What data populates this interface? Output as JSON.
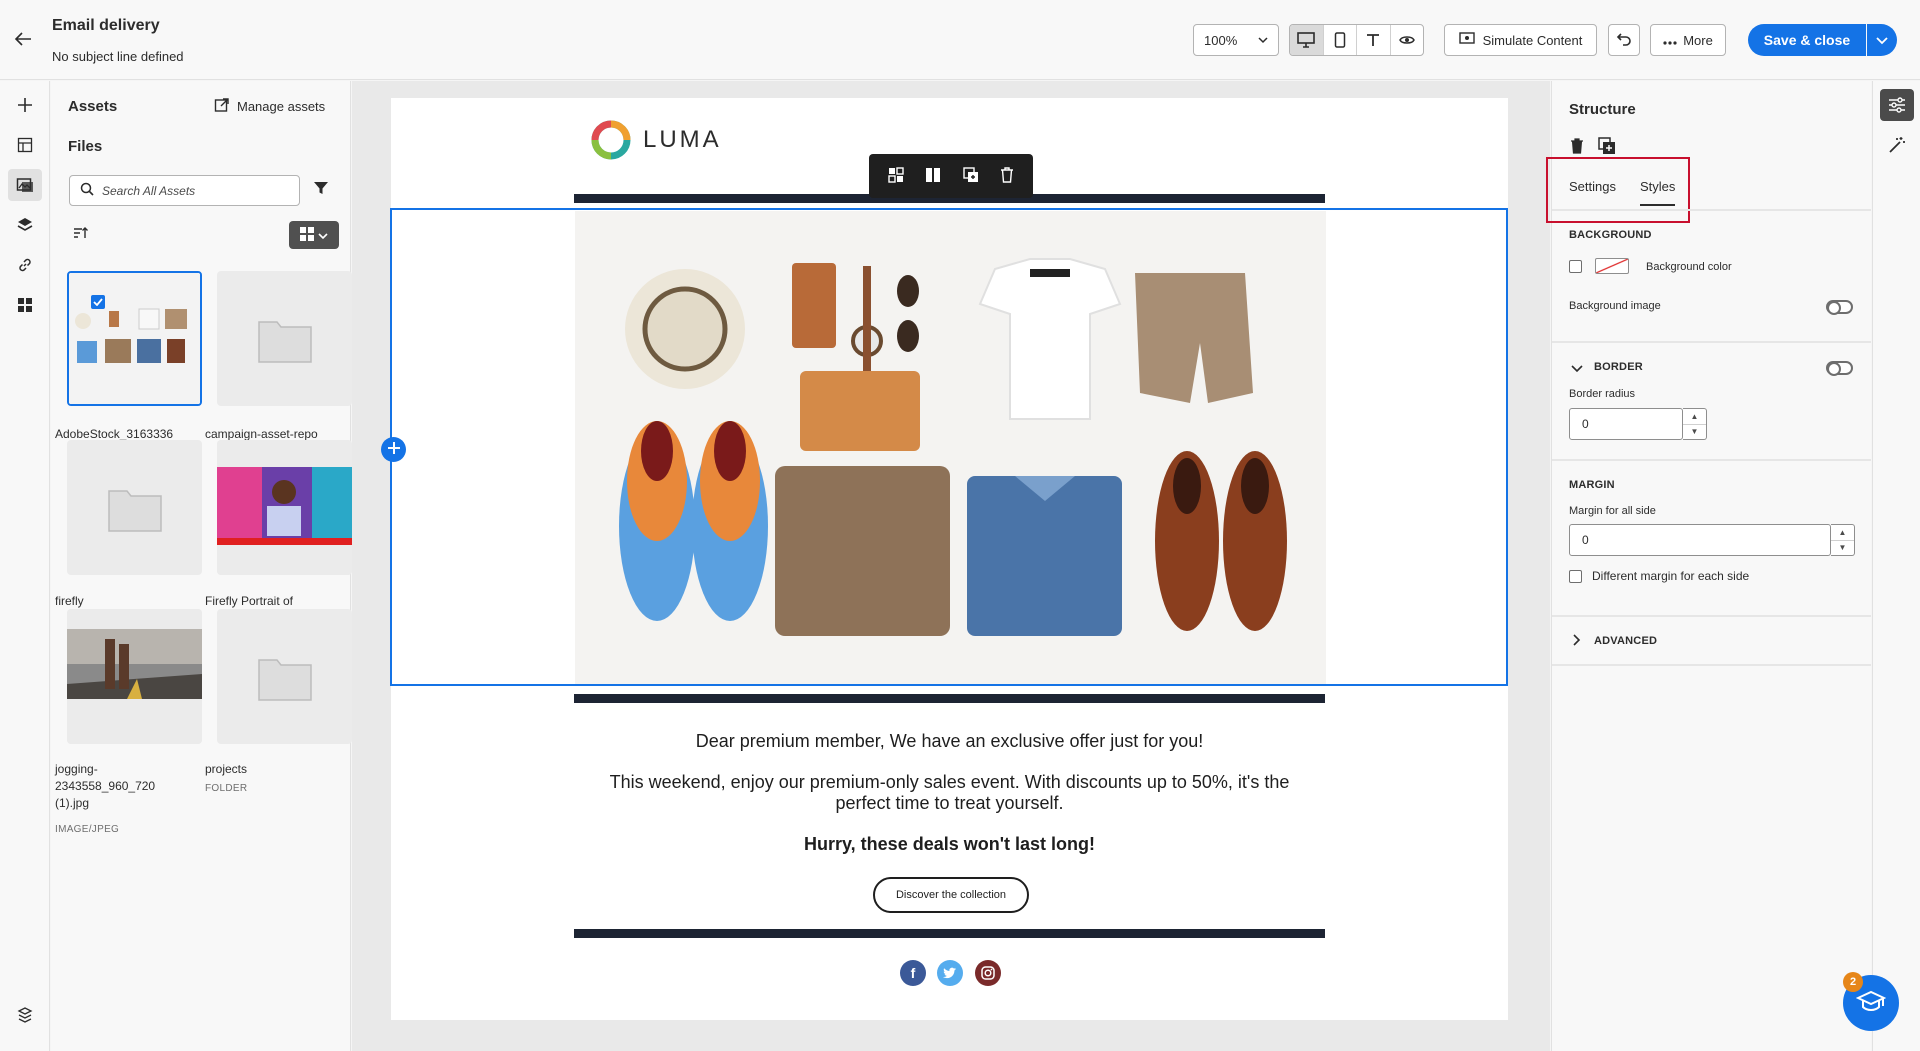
{
  "header": {
    "title": "Email delivery",
    "subtitle": "No subject line defined",
    "zoom": "100%",
    "simulate_label": "Simulate Content",
    "more_label": "More",
    "save_label": "Save & close"
  },
  "left_rail": {
    "icons": [
      "add-icon",
      "fragments-icon",
      "assets-icon",
      "layers-icon",
      "link-icon",
      "components-icon",
      "history-icon"
    ]
  },
  "assets": {
    "title": "Assets",
    "manage_label": "Manage assets",
    "files_heading": "Files",
    "search_placeholder": "Search All Assets",
    "items": [
      {
        "name": "AdobeStock_3163336",
        "type": "",
        "kind": "image",
        "selected": true
      },
      {
        "name": "campaign-asset-repo",
        "type": "",
        "kind": "folder",
        "selected": false
      },
      {
        "name": "firefly",
        "type": "",
        "kind": "folder",
        "selected": false
      },
      {
        "name": "Firefly Portrait of",
        "type": "",
        "kind": "image",
        "selected": false
      },
      {
        "name": "jogging-2343558_960_720 (1).jpg",
        "type": "IMAGE/JPEG",
        "kind": "image",
        "selected": false
      },
      {
        "name": "projects",
        "type": "FOLDER",
        "kind": "folder",
        "selected": false
      }
    ]
  },
  "email": {
    "logo_text": "LUMA",
    "greeting": "Dear premium member, We have an exclusive offer just for you!",
    "body": "This weekend, enjoy our premium-only sales event. With discounts up to 50%, it's the perfect time to treat yourself.",
    "urgency": "Hurry, these deals won't last long!",
    "cta_label": "Discover the collection",
    "social": [
      "facebook-icon",
      "twitter-icon",
      "instagram-icon"
    ]
  },
  "properties": {
    "title": "Structure",
    "tabs": [
      {
        "label": "Settings",
        "active": false
      },
      {
        "label": "Styles",
        "active": true
      }
    ],
    "background": {
      "heading": "BACKGROUND",
      "color_label": "Background color",
      "image_label": "Background image"
    },
    "border": {
      "heading": "BORDER",
      "radius_label": "Border radius",
      "radius_value": "0"
    },
    "margin": {
      "heading": "MARGIN",
      "all_label": "Margin for all side",
      "all_value": "0",
      "each_label": "Different margin for each side"
    },
    "advanced": {
      "heading": "ADVANCED"
    }
  },
  "help": {
    "badge": "2"
  },
  "colors": {
    "accent": "#1473e6",
    "highlight": "#c8102e",
    "dark": "#1d2433"
  }
}
